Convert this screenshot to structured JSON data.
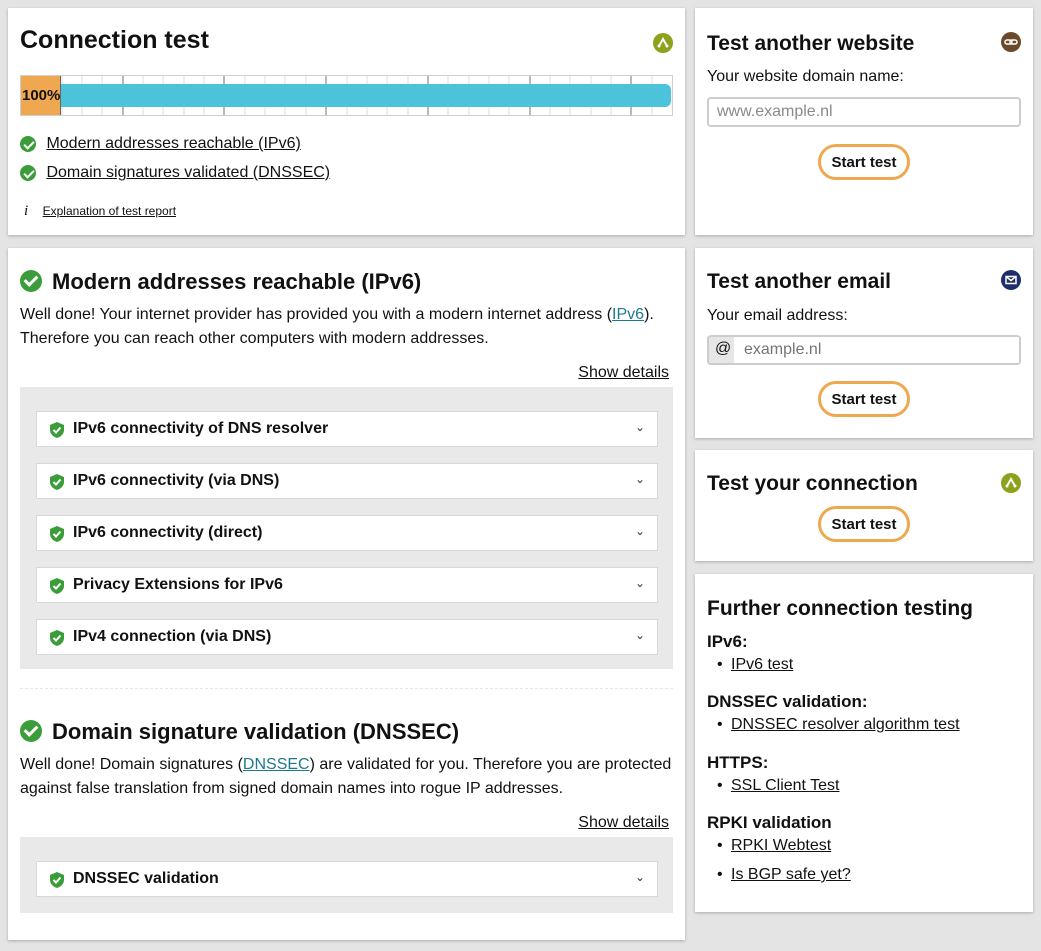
{
  "connection_test": {
    "title": "Connection test",
    "progress_label": "100%",
    "progress": 1.0,
    "results": [
      {
        "label": "Modern addresses reachable (IPv6)"
      },
      {
        "label": "Domain signatures validated (DNSSEC)"
      }
    ],
    "explanation_link": "Explanation of test report"
  },
  "ipv6_section": {
    "title": "Modern addresses reachable (IPv6)",
    "text_before": "Well done! Your internet provider has provided you with a modern internet address (",
    "link": "IPv6",
    "text_after": ").",
    "text_line2": "Therefore you can reach other computers with modern addresses.",
    "show_details": "Show details",
    "items": [
      "IPv6 connectivity of DNS resolver",
      "IPv6 connectivity (via DNS)",
      "IPv6 connectivity (direct)",
      "Privacy Extensions for IPv6",
      "IPv4 connection (via DNS)"
    ]
  },
  "dnssec_section": {
    "title": "Domain signature validation (DNSSEC)",
    "text_before": "Well done! Domain signatures (",
    "link": "DNSSEC",
    "text_after": ") are validated for you. Therefore you are protected",
    "text_line2": "against false translation from signed domain names into rogue IP addresses.",
    "show_details": "Show details",
    "items": [
      "DNSSEC validation"
    ]
  },
  "test_website": {
    "title": "Test another website",
    "label": "Your website domain name:",
    "placeholder": "www.example.nl",
    "button": "Start test"
  },
  "test_email": {
    "title": "Test another email",
    "label": "Your email address:",
    "prefix": "@",
    "placeholder": "example.nl",
    "button": "Start test"
  },
  "test_connection": {
    "title": "Test your connection",
    "button": "Start test"
  },
  "further": {
    "title": "Further connection testing",
    "groups": [
      {
        "heading": "IPv6:",
        "links": [
          "IPv6 test"
        ]
      },
      {
        "heading": "DNSSEC validation:",
        "links": [
          "DNSSEC resolver algorithm test"
        ]
      },
      {
        "heading": "HTTPS:",
        "links": [
          "SSL Client Test"
        ]
      },
      {
        "heading": "RPKI validation",
        "links": [
          "RPKI Webtest",
          "Is BGP safe yet?"
        ]
      }
    ]
  },
  "colors": {
    "progress_fill": "#4cc3da",
    "progress_badge": "#f0a850",
    "button_border": "#f0a850",
    "check_green": "#3a9d3a",
    "connection_icon": "#8ea11b",
    "link_icon": "#6b4a2b",
    "mail_icon": "#1f2d6b",
    "inline_link": "#1a7a8c"
  }
}
